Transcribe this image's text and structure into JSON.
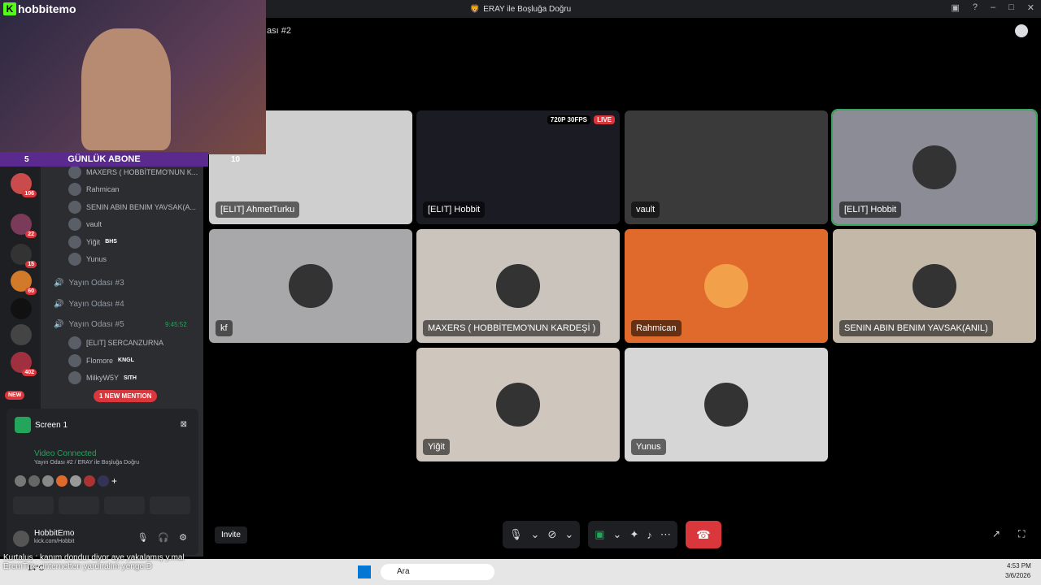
{
  "window": {
    "title": "ERAY ile Boşluğa Doğru",
    "room": "ası #2"
  },
  "overlay": {
    "brand": "hobbitemo",
    "count": "5",
    "abone": "GÜNLÜK ABONE",
    "ten": "10"
  },
  "tiles": [
    {
      "name": "[ELIT] AhmetTurku",
      "color": "#cfcfcf"
    },
    {
      "name": "[ELIT] Hobbit",
      "color": "#1b1b24",
      "live": "LIVE",
      "res": "720P 30FPS"
    },
    {
      "name": "vault",
      "color": "#3a3a3a"
    },
    {
      "name": "[ELIT] Hobbit",
      "color": "#8b8c95"
    },
    {
      "name": "kf",
      "color": "#a8a8aa"
    },
    {
      "name": "MAXERS ( HOBBİTEMO'NUN KARDEŞİ )",
      "color": "#cac4bd"
    },
    {
      "name": "Rahmican",
      "color": "#e06a2c"
    },
    {
      "name": "SENIN ABIN BENIM YAVSAK(ANIL)",
      "color": "#c4b8a8"
    },
    {
      "name": "Yiğit",
      "color": "#cfc6bd"
    },
    {
      "name": "Yunus",
      "color": "#d6d6d6"
    }
  ],
  "users": [
    {
      "name": "MAXERS ( HOBBİTEMO'NUN K..."
    },
    {
      "name": "Rahmican"
    },
    {
      "name": "SENIN ABIN BENIM YAVSAK(A..."
    },
    {
      "name": "vault"
    },
    {
      "name": "Yiğit",
      "tag": "BHS"
    },
    {
      "name": "Yunus"
    }
  ],
  "channels": [
    {
      "name": "Yayın Odası #3"
    },
    {
      "name": "Yayın Odası #4"
    },
    {
      "name": "Yayın Odası #5",
      "time": "9:45:52"
    }
  ],
  "room5": [
    {
      "name": "[ELIT] SERCANZURNA"
    },
    {
      "name": "Flomore",
      "tag": "KNGL"
    },
    {
      "name": "MilkyW5Y",
      "tag": "SITH"
    }
  ],
  "badges": [
    "106",
    "22",
    "15",
    "60",
    "402"
  ],
  "mention": "1 NEW MENTION",
  "newtag": "NEW",
  "screen": "Screen 1",
  "voice": {
    "status": "Video Connected",
    "where": "Yayın Odası #2 / ERAY ile Boşluğa Doğru"
  },
  "me": {
    "name": "HobbitEmo",
    "sub": "kick.com/Hobbit"
  },
  "invite": "Invite",
  "ticker": "Kurtalus : kanım donduı diyor aye yakalamış y.mal",
  "ticker2": "EremTrix : internetten yardıralım yenge:D",
  "taskbar": {
    "search": "Ara",
    "time": "4:53 PM",
    "date": "3/6/2026",
    "temp": "14°C"
  }
}
